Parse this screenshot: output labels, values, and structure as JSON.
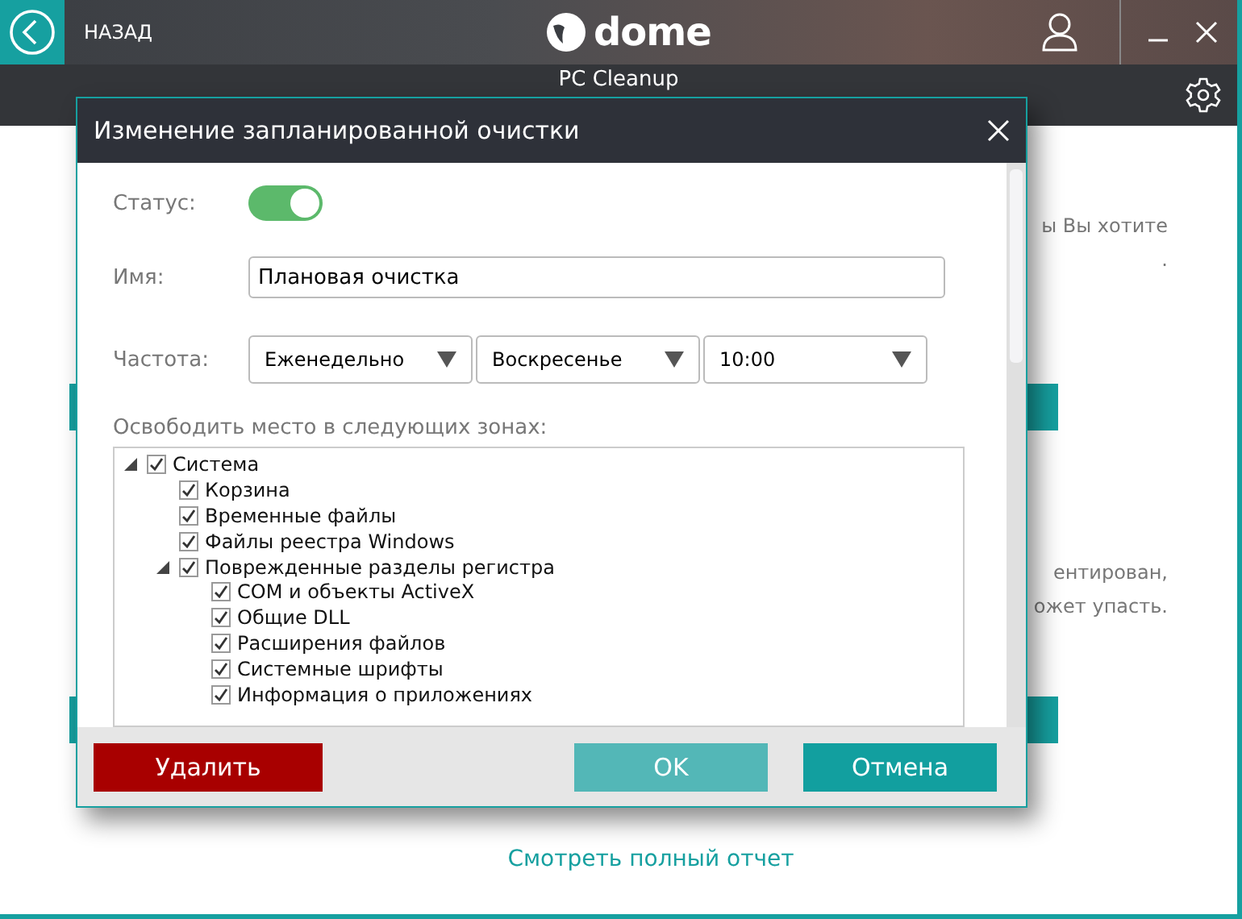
{
  "header": {
    "back_label": "НАЗАД",
    "logo_text": "dome",
    "subtitle": "PC Cleanup"
  },
  "background": {
    "fragments_top": [
      "ы Вы хотите",
      "."
    ],
    "fragments_mid": [
      "ентирован,",
      "ожет упасть."
    ],
    "report_link": "Смотреть полный отчет"
  },
  "dialog": {
    "title": "Изменение запланированной очистки",
    "status": {
      "label": "Статус:",
      "on": true
    },
    "name": {
      "label": "Имя:",
      "value": "Плановая очистка"
    },
    "frequency": {
      "label": "Частота:",
      "dropdowns": [
        "Еженедельно",
        "Воскресенье",
        "10:00"
      ]
    },
    "zones_label": "Освободить место в следующих зонах:",
    "tree": [
      {
        "label": "Система",
        "checked": true,
        "expanded": true,
        "children": [
          {
            "label": "Корзина",
            "checked": true
          },
          {
            "label": "Временные файлы",
            "checked": true
          },
          {
            "label": "Файлы реестра Windows",
            "checked": true
          },
          {
            "label": "Поврежденные разделы регистра",
            "checked": true,
            "expanded": true,
            "children": [
              {
                "label": "COM и объекты ActiveX",
                "checked": true
              },
              {
                "label": "Общие DLL",
                "checked": true
              },
              {
                "label": "Расширения файлов",
                "checked": true
              },
              {
                "label": "Системные шрифты",
                "checked": true
              },
              {
                "label": "Информация о приложениях",
                "checked": true
              }
            ]
          }
        ]
      }
    ],
    "buttons": [
      {
        "label": "Удалить",
        "kind": "danger"
      },
      {
        "label": "OK",
        "kind": "primary-light"
      },
      {
        "label": "Отмена",
        "kind": "primary"
      }
    ]
  }
}
